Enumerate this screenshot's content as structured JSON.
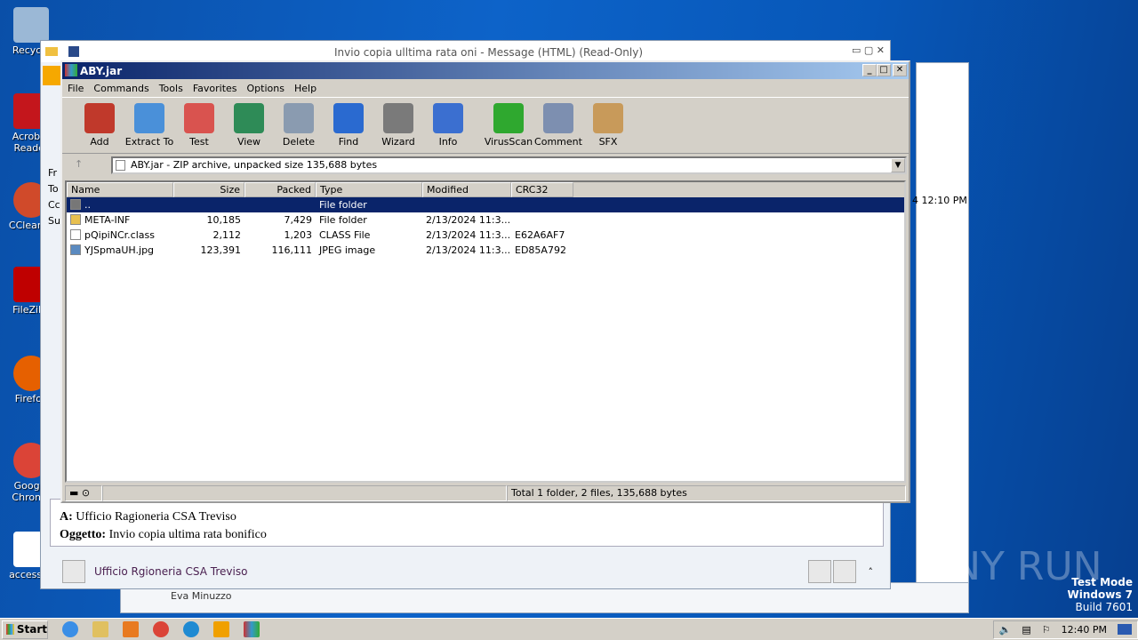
{
  "desktop": {
    "icons": [
      "Recycle",
      "Acrobat Reader",
      "CCleaner",
      "FileZilla",
      "Firefox",
      "Google Chrome",
      "accessac"
    ],
    "watermark": [
      "Test Mode",
      "Windows 7",
      "Build 7601"
    ],
    "anyrun": "ANY RUN"
  },
  "outlook": {
    "title": "Invio copia ulltima rata oni -  Message (HTML) (Read-Only)",
    "header_time": "4 12:10 PM",
    "side_labels": [
      "Fr",
      "To",
      "Cc",
      "Su"
    ],
    "to_label": "A:",
    "to_value": "Ufficio Ragioneria CSA Treviso",
    "subject_label": "Oggetto:",
    "subject_value": "Invio copia ultima rata bonifico",
    "contact": "Ufficio Rgioneria CSA Treviso",
    "back_contact": "Eva Minuzzo"
  },
  "winrar": {
    "title": "ABY.jar",
    "menu": [
      "File",
      "Commands",
      "Tools",
      "Favorites",
      "Options",
      "Help"
    ],
    "toolbar": [
      {
        "label": "Add",
        "color": "#c0392b"
      },
      {
        "label": "Extract To",
        "color": "#4a90d9"
      },
      {
        "label": "Test",
        "color": "#d9534f"
      },
      {
        "label": "View",
        "color": "#2e8b57"
      },
      {
        "label": "Delete",
        "color": "#8a9bb0"
      },
      {
        "label": "Find",
        "color": "#2a6ad0"
      },
      {
        "label": "Wizard",
        "color": "#7a7a7a"
      },
      {
        "label": "Info",
        "color": "#3b6fd0"
      },
      {
        "label": "VirusScan",
        "color": "#2fa82f"
      },
      {
        "label": "Comment",
        "color": "#7d8fb0"
      },
      {
        "label": "SFX",
        "color": "#c89a5a"
      }
    ],
    "address": "ABY.jar - ZIP archive, unpacked size 135,688 bytes",
    "columns": [
      "Name",
      "Size",
      "Packed",
      "Type",
      "Modified",
      "CRC32"
    ],
    "rows": [
      [
        "..",
        "",
        "",
        "File folder",
        "",
        ""
      ],
      [
        "META-INF",
        "10,185",
        "7,429",
        "File folder",
        "2/13/2024 11:3...",
        ""
      ],
      [
        "pQipiNCr.class",
        "2,112",
        "1,203",
        "CLASS File",
        "2/13/2024 11:3...",
        "E62A6AF7"
      ],
      [
        "YJSpmaUH.jpg",
        "123,391",
        "116,111",
        "JPEG image",
        "2/13/2024 11:3...",
        "ED85A792"
      ]
    ],
    "status": "Total 1 folder, 2 files, 135,688 bytes"
  },
  "taskbar": {
    "start": "Start",
    "clock": "12:40 PM"
  }
}
